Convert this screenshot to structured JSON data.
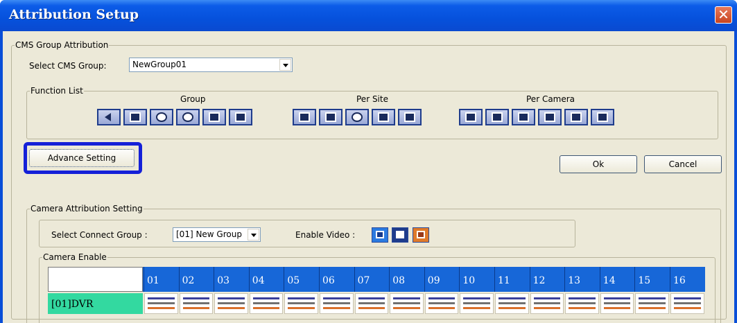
{
  "window": {
    "title": "Attribution Setup",
    "close_glyph": "✕"
  },
  "cms_group": {
    "legend": "CMS Group Attribution",
    "select_label": "Select CMS Group:",
    "selected_value": "NewGroup01"
  },
  "function_list": {
    "legend": "Function List",
    "group_label": "Group",
    "per_site_label": "Per Site",
    "per_camera_label": "Per Camera",
    "group_icons": [
      "back-arrow-icon",
      "monitor-grid-icon",
      "globe-icon",
      "clock-icon",
      "edit-icon",
      "lock-icon"
    ],
    "site_icons": [
      "network-icon",
      "camera-icon",
      "settings-icon",
      "search-icon",
      "record-icon"
    ],
    "camera_icons": [
      "fullscreen-icon",
      "edit-window-icon",
      "playback-icon",
      "keyboard-icon",
      "tilt-icon",
      "speaker-icon"
    ]
  },
  "buttons": {
    "advance": "Advance Setting",
    "ok": "Ok",
    "cancel": "Cancel"
  },
  "camera_attribution": {
    "legend": "Camera Attribution Setting",
    "connect_label": "Select Connect Group :",
    "connect_value": "[01] New Group",
    "enable_video_label": "Enable Video :",
    "enable_icons": [
      "display-icon",
      "back-arrow-icon",
      "camera-icon"
    ],
    "camera_enable_legend": "Camera Enable",
    "channels": [
      "01",
      "02",
      "03",
      "04",
      "05",
      "06",
      "07",
      "08",
      "09",
      "10",
      "11",
      "12",
      "13",
      "14",
      "15",
      "16"
    ],
    "dvr_label": "[01]DVR"
  },
  "colors": {
    "accent": "#1767d8",
    "dvr_highlight": "#33d9a0",
    "focus_ring": "#1420d8"
  }
}
